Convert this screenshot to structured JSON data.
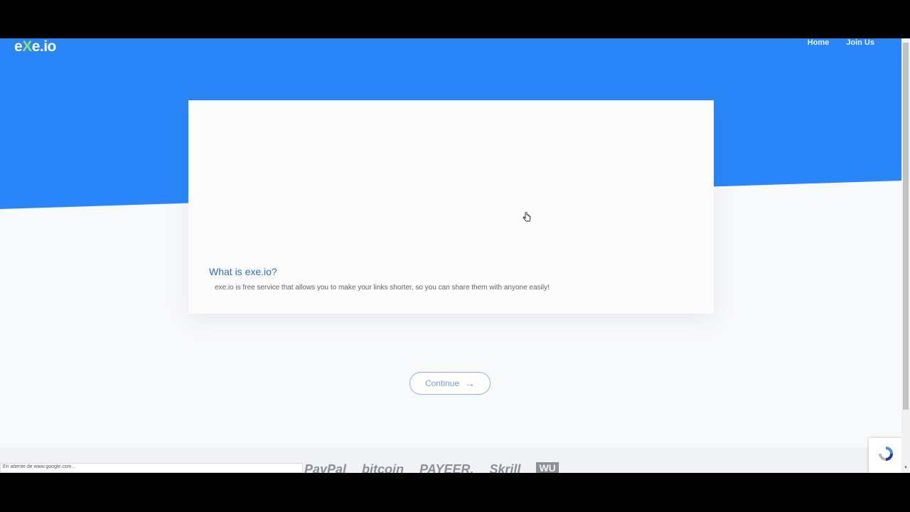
{
  "site": {
    "logo_prefix": "e",
    "logo_x": "X",
    "logo_suffix": "e.io",
    "hero_color": "#2a86f8"
  },
  "nav": {
    "home": "Home",
    "join_us": "Join Us"
  },
  "card": {
    "title": "What is exe.io?",
    "description": "exe.io is free service that allows you to make your links shorter, so you can share them with anyone easily!"
  },
  "actions": {
    "continue_label": "Continue",
    "continue_icon": "→"
  },
  "payments": [
    "PayPal",
    "bitcoin",
    "PAYEER.",
    "Skrill",
    "WU"
  ],
  "status": {
    "text": "En attente de www.google.com..."
  },
  "icons": [
    "hand-cursor-icon",
    "recaptcha-icon",
    "arrow-right-icon"
  ]
}
